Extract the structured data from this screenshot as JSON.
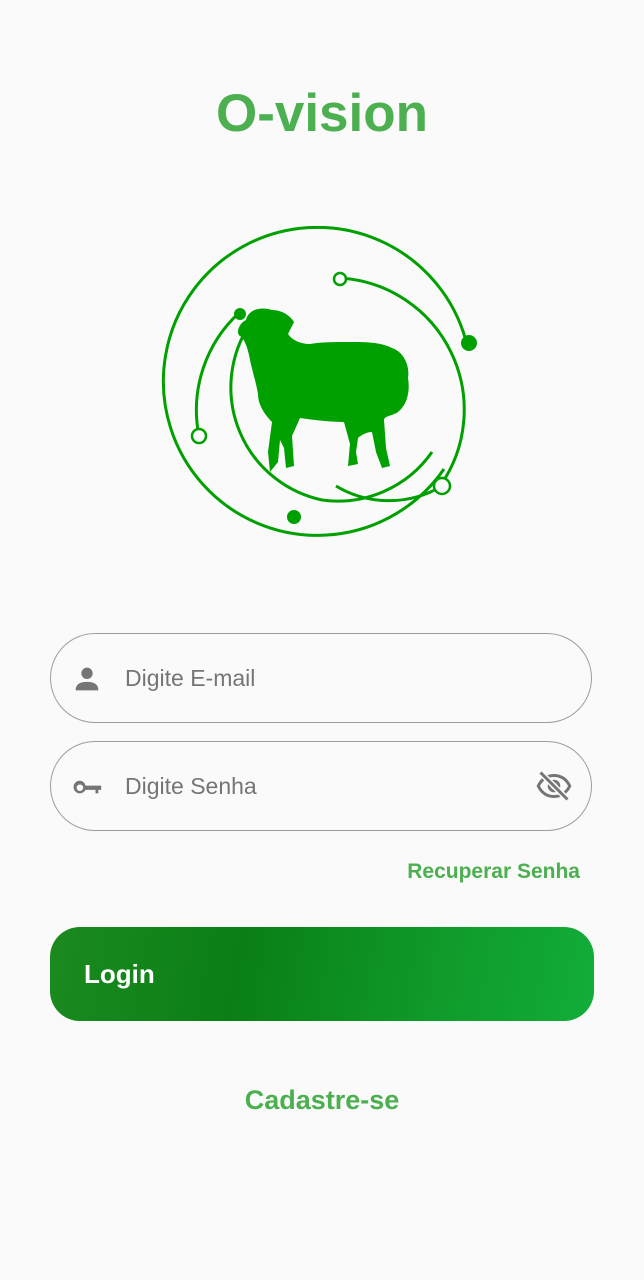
{
  "app": {
    "title": "O-vision"
  },
  "logo": {
    "icon": "sheep-circuit-logo",
    "color": "#00a000"
  },
  "login_form": {
    "email": {
      "placeholder": "Digite E-mail",
      "value": "",
      "icon": "person-icon"
    },
    "password": {
      "placeholder": "Digite Senha",
      "value": "",
      "icon": "key-icon",
      "toggle_icon": "eye-off-icon"
    },
    "recover_link": "Recuperar Senha",
    "login_button": "Login",
    "signup_link": "Cadastre-se"
  },
  "colors": {
    "accent": "#4caf50",
    "button_gradient_start": "#0a7f16",
    "button_gradient_end": "#12ad3a",
    "field_border": "#9e9e9e",
    "icon_gray": "#757575"
  }
}
